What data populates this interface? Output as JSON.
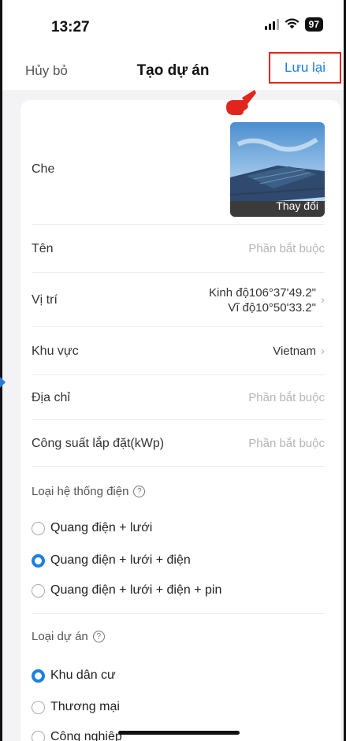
{
  "status_bar": {
    "time": "13:27",
    "battery": "97",
    "signal_icon": "signal-icon",
    "wifi_icon": "wifi-icon"
  },
  "nav": {
    "cancel_label": "Hủy bỏ",
    "title": "Tạo dự án",
    "save_label": "Lưu lại"
  },
  "colors": {
    "accent": "#1e7fe0",
    "highlight_box": "#e0261c",
    "pointer": "#e0261c",
    "background": "#f3f3f5"
  },
  "form": {
    "cover": {
      "label": "Che",
      "change_label": "Thay đổi"
    },
    "name": {
      "label": "Tên",
      "placeholder": "Phần bắt buộc"
    },
    "location": {
      "label": "Vị trí",
      "longitude": "Kinh độ106°37'49.2\"",
      "latitude": "Vĩ độ10°50'33.2\""
    },
    "region": {
      "label": "Khu vực",
      "value": "Vietnam"
    },
    "address": {
      "label": "Địa chỉ",
      "placeholder": "Phần bắt buộc"
    },
    "capacity": {
      "label": "Công suất lắp đặt(kWp)",
      "placeholder": "Phần bắt buộc"
    }
  },
  "system_type": {
    "title": "Loại hệ thống điện",
    "options": [
      {
        "label": "Quang điện + lưới",
        "selected": false
      },
      {
        "label": "Quang điện + lưới + điện",
        "selected": true
      },
      {
        "label": "Quang điện + lưới + điện + pin",
        "selected": false
      }
    ]
  },
  "project_type": {
    "title": "Loại dự án",
    "options": [
      {
        "label": "Khu dân cư",
        "selected": true
      },
      {
        "label": "Thương mại",
        "selected": false
      },
      {
        "label": "Công nghiệp",
        "selected": false
      }
    ]
  }
}
